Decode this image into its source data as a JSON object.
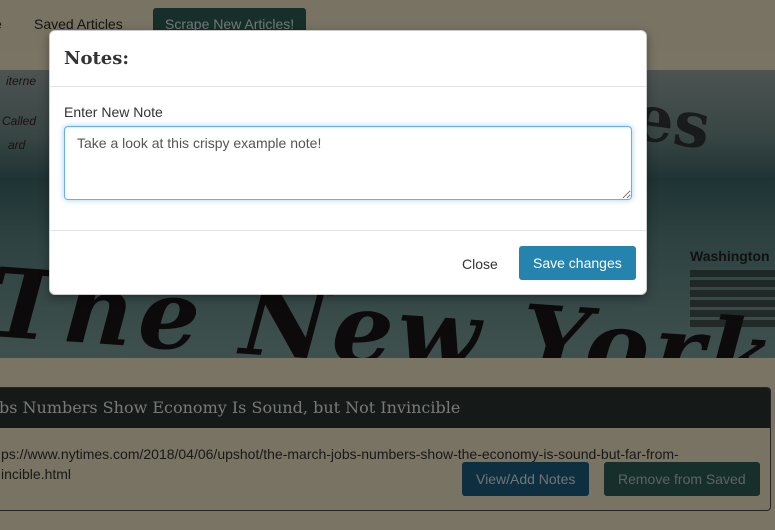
{
  "navbar": {
    "home_label": "e",
    "saved_label": "Saved Articles",
    "scrape_label": "Scrape New Articles!"
  },
  "hero": {
    "masthead_text": "The New York Times",
    "top_text": "mes",
    "side_heading": "Washington",
    "left_fragments": [
      "iterne",
      "Called",
      "ard"
    ]
  },
  "article": {
    "title": "bs Numbers Show Economy Is Sound, but Not Invincible",
    "link_line1": "ps://www.nytimes.com/2018/04/06/upshot/the-march-jobs-numbers-show-the-economy-is-sound-but-far-from-",
    "link_line2": "incible.html",
    "view_notes_label": "View/Add Notes",
    "remove_label": "Remove from Saved"
  },
  "modal": {
    "title": "Notes:",
    "note_label": "Enter New Note",
    "note_value": "Take a look at this crispy example note!",
    "close_label": "Close",
    "save_label": "Save changes"
  }
}
